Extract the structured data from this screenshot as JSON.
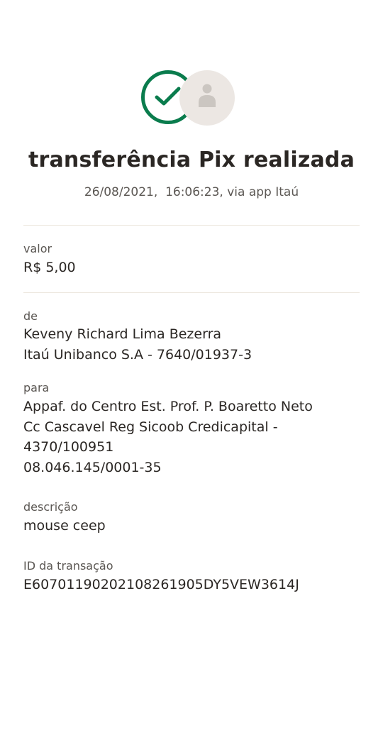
{
  "header": {
    "title": "transferência Pix realizada",
    "subtitle": "26/08/2021,  16:06:23, via app Itaú",
    "success_icon": "check-circle-icon",
    "avatar_icon": "person-icon",
    "success_color": "#0a7c4d"
  },
  "valor": {
    "label": "valor",
    "value": "R$ 5,00"
  },
  "de": {
    "label": "de",
    "lines": [
      "Keveny Richard Lima Bezerra",
      "Itaú Unibanco S.A - 7640/01937-3"
    ]
  },
  "para": {
    "label": "para",
    "lines": [
      "Appaf. do Centro Est. Prof. P. Boaretto Neto",
      "Cc Cascavel Reg Sicoob Credicapital -",
      "4370/100951",
      "08.046.145/0001-35"
    ]
  },
  "descricao": {
    "label": "descrição",
    "value": "mouse ceep"
  },
  "transacao": {
    "label": "ID da transação",
    "value": "E60701190202108261905DY5VEW3614J"
  }
}
